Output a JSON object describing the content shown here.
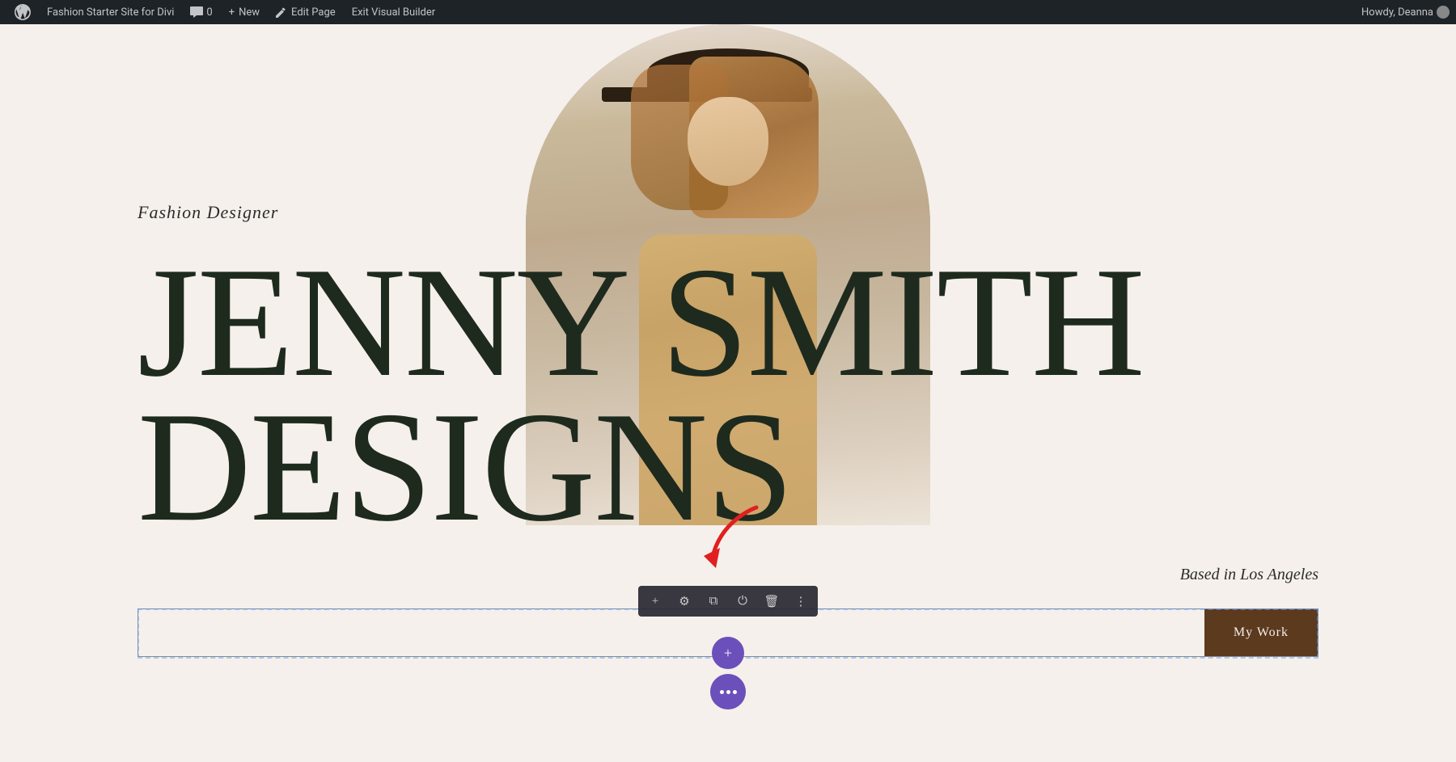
{
  "adminbar": {
    "site_name": "Fashion Starter Site for Divi",
    "comments_count": "0",
    "new_label": "New",
    "edit_page_label": "Edit Page",
    "exit_builder_label": "Exit Visual Builder",
    "howdy_text": "Howdy, Deanna"
  },
  "hero": {
    "subtitle": "Fashion Designer",
    "title_line1": "JENNY SMITH",
    "title_line2": "DESIGNS",
    "location": "Based in Los Angeles",
    "cta_button": "My Work"
  },
  "toolbar": {
    "add_icon": "+",
    "settings_icon": "⚙",
    "clone_icon": "⧉",
    "power_icon": "⏻",
    "trash_icon": "🗑",
    "more_icon": "⋮"
  },
  "colors": {
    "dark_green": "#1e2a1e",
    "brown_button": "#5c3a1e",
    "page_bg": "#f5f0eb",
    "admin_bar": "#1d2327",
    "purple": "#6b4fbb"
  }
}
